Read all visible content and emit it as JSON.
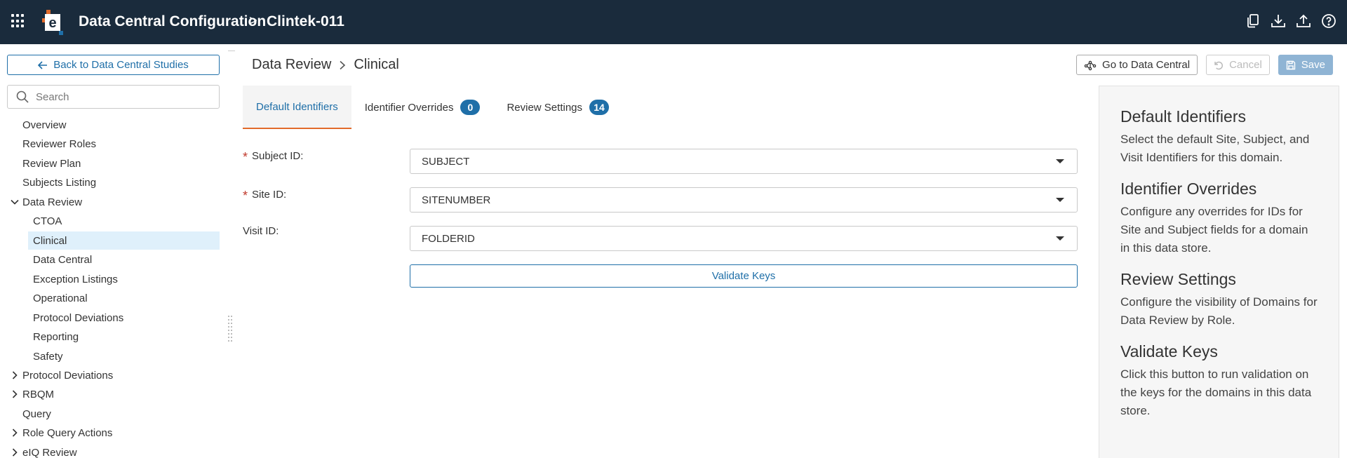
{
  "header": {
    "app_title": "Data Central Configuration",
    "separator": ">",
    "study_name": "Clintek-011",
    "icons": [
      "copy-icon",
      "download-icon",
      "upload-icon",
      "help-icon"
    ]
  },
  "sidebar": {
    "back_label": "Back to Data Central Studies",
    "search_placeholder": "Search",
    "items": [
      {
        "label": "Overview"
      },
      {
        "label": "Reviewer Roles"
      },
      {
        "label": "Review Plan"
      },
      {
        "label": "Subjects Listing"
      },
      {
        "label": "Data Review",
        "expanded": true
      },
      {
        "label": "CTOA"
      },
      {
        "label": "Clinical",
        "selected": true
      },
      {
        "label": "Data Central"
      },
      {
        "label": "Exception Listings"
      },
      {
        "label": "Operational"
      },
      {
        "label": "Protocol Deviations"
      },
      {
        "label": "Reporting"
      },
      {
        "label": "Safety"
      },
      {
        "label": "Protocol Deviations",
        "expanded": false
      },
      {
        "label": "RBQM",
        "expanded": false
      },
      {
        "label": "Query"
      },
      {
        "label": "Role Query Actions",
        "expanded": false
      },
      {
        "label": "eIQ Review",
        "expanded": false
      }
    ]
  },
  "breadcrumb": {
    "parent": "Data Review",
    "current": "Clinical"
  },
  "actions": {
    "go_to": "Go to Data Central",
    "cancel": "Cancel",
    "save": "Save"
  },
  "tabs": [
    {
      "label": "Default Identifiers",
      "active": true
    },
    {
      "label": "Identifier Overrides",
      "count": "0"
    },
    {
      "label": "Review Settings",
      "count": "14"
    }
  ],
  "form": {
    "subject_label": "Subject ID:",
    "subject_value": "SUBJECT",
    "site_label": "Site ID:",
    "site_value": "SITENUMBER",
    "visit_label": "Visit ID:",
    "visit_value": "FOLDERID",
    "required_mark": "*",
    "validate_label": "Validate Keys"
  },
  "help": [
    {
      "title": "Default Identifiers",
      "text": "Select the default Site, Subject, and Visit Identifiers for this domain."
    },
    {
      "title": "Identifier Overrides",
      "text": "Configure any overrides for IDs for Site and Subject fields for a domain in this data store."
    },
    {
      "title": "Review Settings",
      "text": "Configure the visibility of Domains for Data Review by Role."
    },
    {
      "title": "Validate Keys",
      "text": "Click this button to run validation on the keys for the domains in this data store."
    }
  ],
  "colors": {
    "topbar": "#1a2b3c",
    "accent": "#1f6fa8",
    "tab_underline": "#e26b2b",
    "selected_bg": "#dff0fb"
  }
}
